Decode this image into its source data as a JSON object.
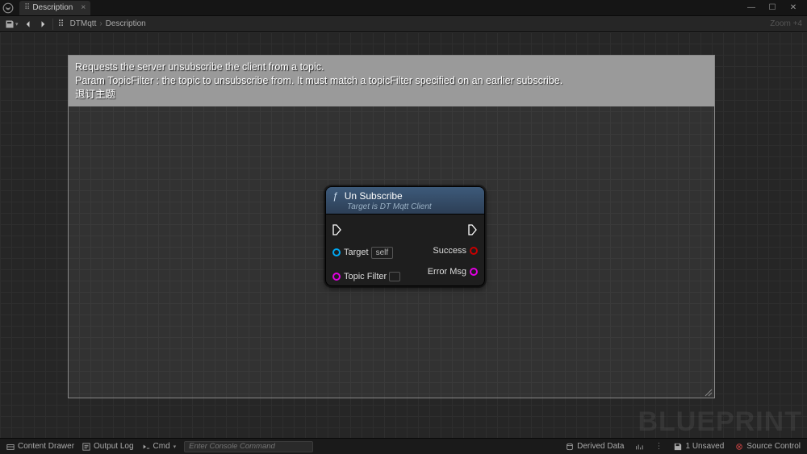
{
  "titlebar": {
    "tab_label": "Description"
  },
  "toolbar": {
    "breadcrumb": {
      "seg0": "DTMqtt",
      "seg1": "Description"
    },
    "zoom_label": "Zoom +4"
  },
  "description": {
    "line1": "Requests the server unsubscribe the client from a topic.",
    "line2": "Param TopicFilter : the topic to unsubscribe from. It must match a topicFilter specified on an earlier subscribe.",
    "line3": "退订主题"
  },
  "node": {
    "title": "Un Subscribe",
    "subtitle": "Target is DT Mqtt Client",
    "inputs": {
      "target_label": "Target",
      "target_value": "self",
      "topic_filter_label": "Topic Filter",
      "topic_filter_value": ""
    },
    "outputs": {
      "success_label": "Success",
      "error_msg_label": "Error Msg"
    }
  },
  "watermark": "BLUEPRINT",
  "statusbar": {
    "content_drawer": "Content Drawer",
    "output_log": "Output Log",
    "cmd_label": "Cmd",
    "cmd_placeholder": "Enter Console Command",
    "derived_data": "Derived Data",
    "unsaved": "1 Unsaved",
    "source_control": "Source Control"
  }
}
